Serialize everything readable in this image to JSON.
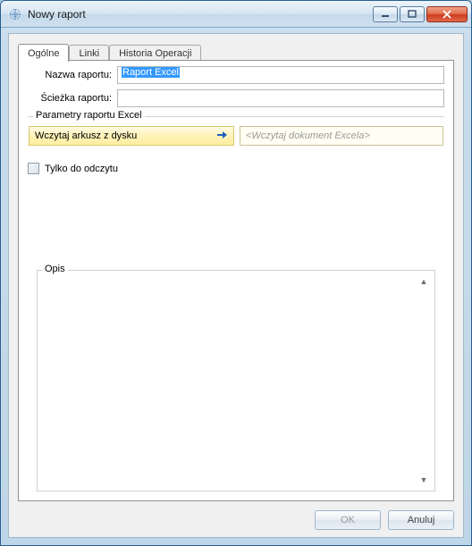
{
  "window": {
    "title": "Nowy raport"
  },
  "tabs": {
    "general": "Ogólne",
    "links": "Linki",
    "history": "Historia Operacji"
  },
  "form": {
    "name_label": "Nazwa raportu:",
    "name_value": "Raport Excel",
    "path_label": "Ścieżka raportu:",
    "path_value": ""
  },
  "params": {
    "legend": "Parametry raportu Excel",
    "load_button": "Wczytaj arkusz z dysku",
    "load_placeholder": "<Wczytaj dokument Excela>",
    "readonly_label": "Tylko do odczytu"
  },
  "description": {
    "legend": "Opis",
    "value": ""
  },
  "buttons": {
    "ok": "OK",
    "cancel": "Anuluj"
  }
}
